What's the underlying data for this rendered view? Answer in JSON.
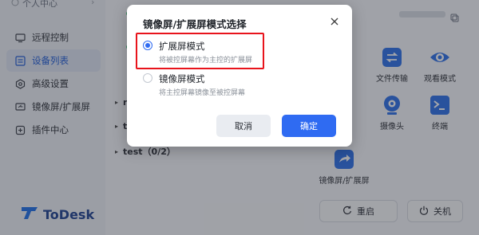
{
  "sidebar": {
    "user_label": "个人中心",
    "items": [
      {
        "label": "远程控制",
        "icon": "remote-control-icon",
        "active": false
      },
      {
        "label": "设备列表",
        "icon": "device-list-icon",
        "active": true
      },
      {
        "label": "高级设置",
        "icon": "settings-icon",
        "active": false
      },
      {
        "label": "镜像屏/扩展屏",
        "icon": "mirror-screen-icon",
        "active": false
      },
      {
        "label": "插件中心",
        "icon": "plugin-icon",
        "active": false
      }
    ],
    "logo_text": "ToDesk"
  },
  "main": {
    "device_rows": [
      {
        "label": "r"
      },
      {
        "label": "t"
      },
      {
        "label": "test（0/2）"
      }
    ],
    "tools": [
      {
        "label": "则",
        "icon": "partial-tool-icon"
      },
      {
        "label": "文件传输",
        "icon": "file-transfer-icon"
      },
      {
        "label": "观看模式",
        "icon": "watch-mode-icon"
      },
      {
        "label": "摄像头",
        "icon": "camera-icon"
      },
      {
        "label": "终端",
        "icon": "terminal-icon"
      },
      {
        "label": "镜像屏/扩展屏",
        "icon": "mirror-screen-tool-icon"
      }
    ],
    "restart_label": "重启",
    "shutdown_label": "关机"
  },
  "dialog": {
    "title": "镜像屏/扩展屏模式选择",
    "options": [
      {
        "label": "扩展屏模式",
        "description": "将被控屏幕作为主控的扩展屏",
        "selected": true
      },
      {
        "label": "镜像屏模式",
        "description": "将主控屏幕镜像至被控屏幕",
        "selected": false
      }
    ],
    "cancel_label": "取消",
    "confirm_label": "确定"
  },
  "colors": {
    "accent": "#2f6bf2",
    "highlight_box": "#e8141c",
    "online": "#38c172"
  }
}
